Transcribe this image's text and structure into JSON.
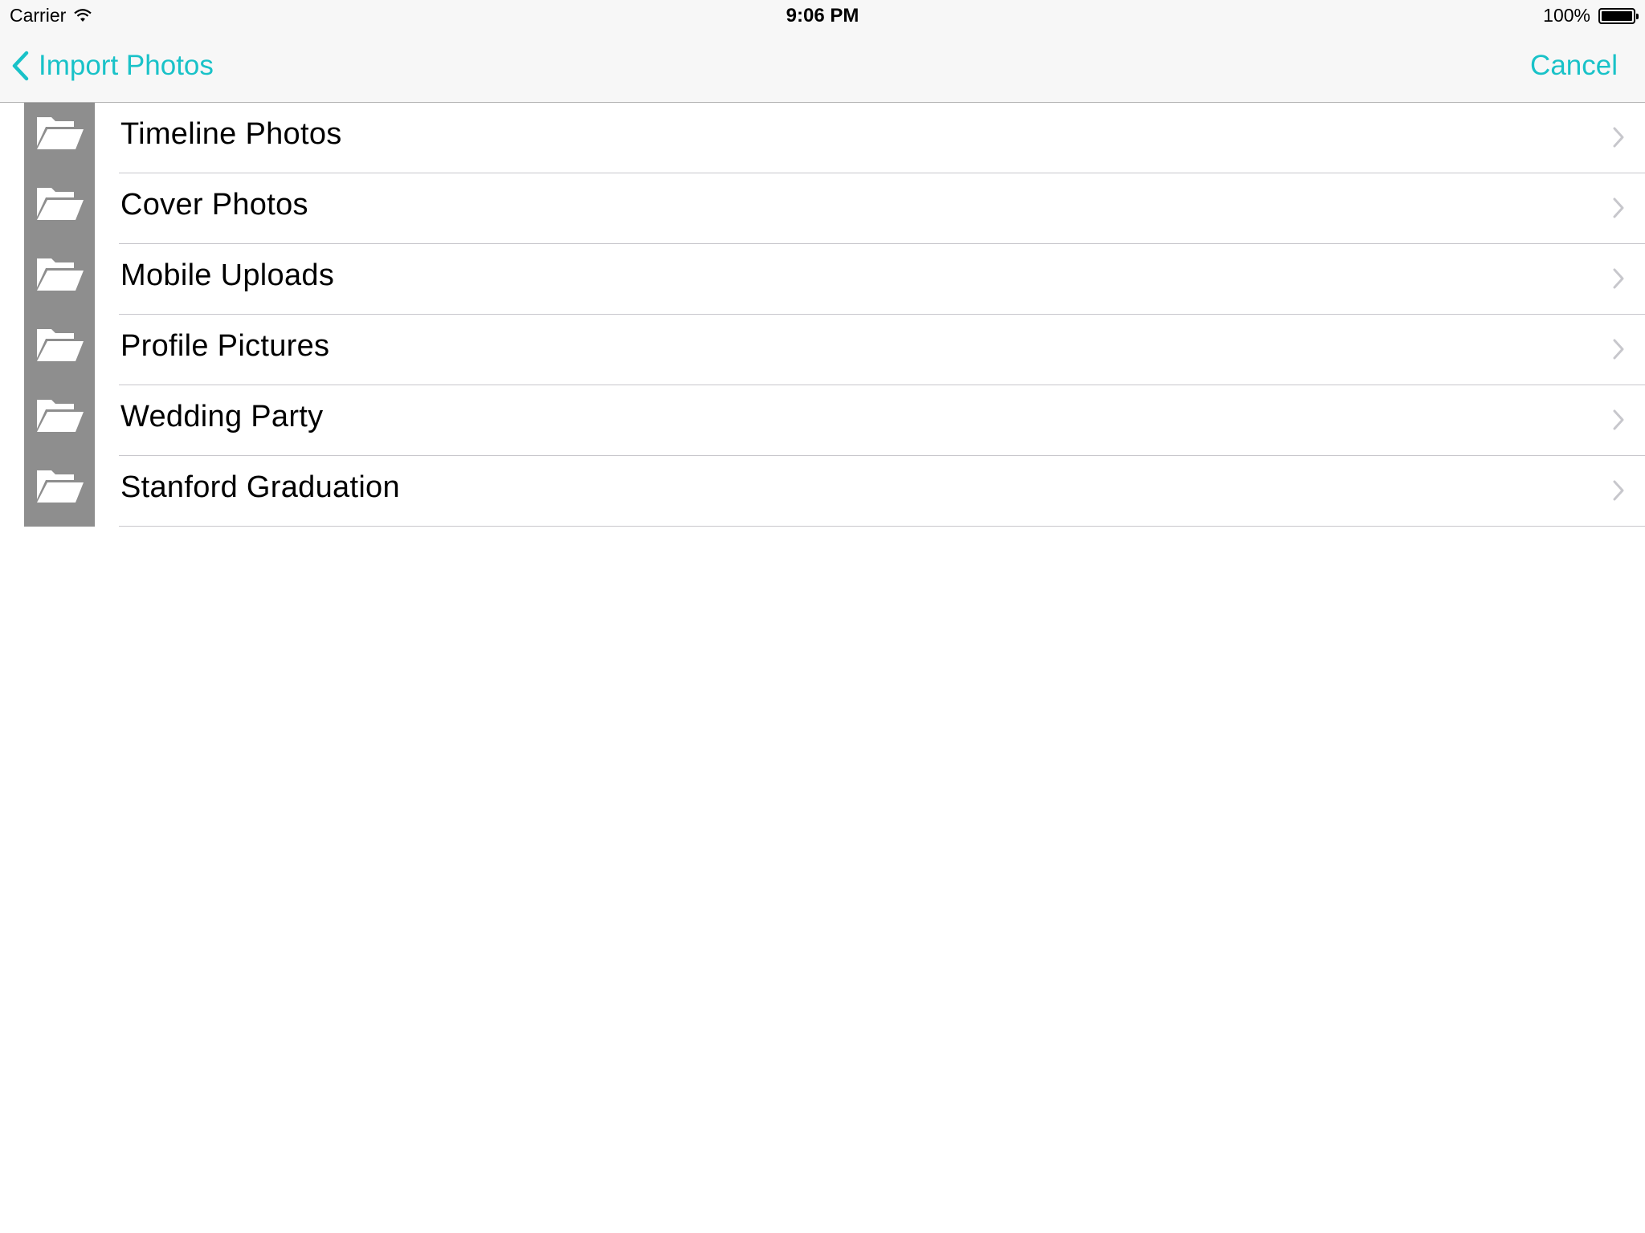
{
  "status_bar": {
    "carrier": "Carrier",
    "time": "9:06 PM",
    "battery_percent_label": "100%",
    "battery_level": 1.0,
    "icons": [
      "wifi-icon",
      "battery-icon"
    ]
  },
  "nav": {
    "back_label": "Import Photos",
    "cancel_label": "Cancel",
    "accent_color": "#19c2c8"
  },
  "albums": [
    {
      "label": "Timeline Photos",
      "icon": "folder-open-icon"
    },
    {
      "label": "Cover Photos",
      "icon": "folder-open-icon"
    },
    {
      "label": "Mobile Uploads",
      "icon": "folder-open-icon"
    },
    {
      "label": "Profile Pictures",
      "icon": "folder-open-icon"
    },
    {
      "label": "Wedding Party",
      "icon": "folder-open-icon"
    },
    {
      "label": "Stanford Graduation",
      "icon": "folder-open-icon"
    }
  ]
}
